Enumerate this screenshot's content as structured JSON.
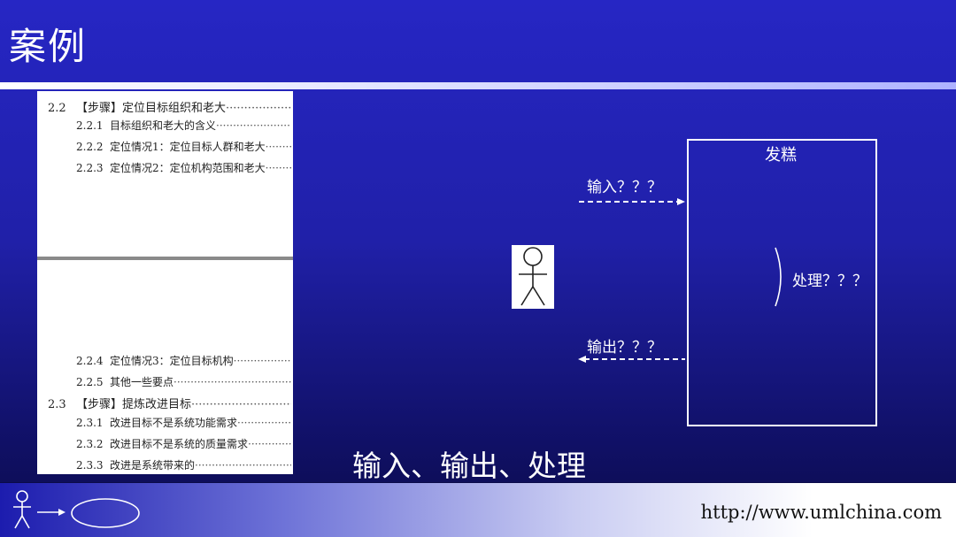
{
  "slide": {
    "title": "案例",
    "caption": "输入、输出、处理",
    "footer_url": "http://www.umlchina.com"
  },
  "toc": {
    "entries": [
      {
        "num": "2.2",
        "text": "【步骤】定位目标组织和老大",
        "level": "major"
      },
      {
        "num": "2.2.1",
        "text": "目标组织和老大的含义",
        "level": "minor"
      },
      {
        "num": "2.2.2",
        "text": "定位情况1：定位目标人群和老大",
        "level": "minor"
      },
      {
        "num": "2.2.3",
        "text": "定位情况2：定位机构范围和老大",
        "level": "minor"
      },
      {
        "num": "2.2.4",
        "text": "定位情况3：定位目标机构",
        "level": "minor"
      },
      {
        "num": "2.2.5",
        "text": "其他一些要点",
        "level": "minor"
      },
      {
        "num": "2.3",
        "text": "【步骤】提炼改进目标",
        "level": "major"
      },
      {
        "num": "2.3.1",
        "text": "改进目标不是系统功能需求",
        "level": "minor"
      },
      {
        "num": "2.3.2",
        "text": "改进目标不是系统的质量需求",
        "level": "minor"
      },
      {
        "num": "2.3.3",
        "text": "改进是系统带来的",
        "level": "minor"
      }
    ]
  },
  "diagram": {
    "system_label": "发糕",
    "input_label": "输入？？？",
    "output_label": "输出？？？",
    "process_label": "处理？？？"
  },
  "icons": {
    "actor": "stick-figure-icon",
    "footer_logo": "actor-usecase-logo-icon"
  },
  "colors": {
    "background_top": "#2626c4",
    "background_bottom": "#0b0b4a",
    "text": "#ffffff"
  }
}
